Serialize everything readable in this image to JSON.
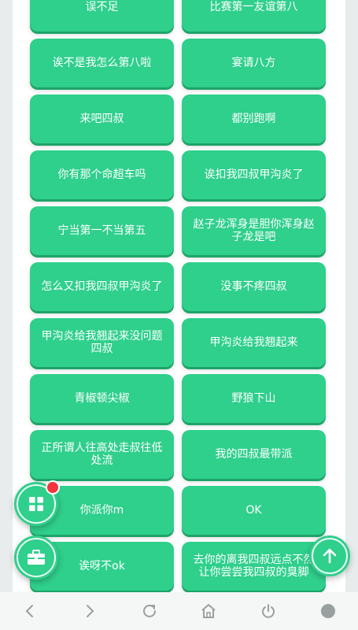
{
  "buttons": [
    {
      "label": "误不足"
    },
    {
      "label": "比赛第一友谊第八"
    },
    {
      "label": "诶不是我怎么第八啦"
    },
    {
      "label": "宴请八方"
    },
    {
      "label": "来吧四叔"
    },
    {
      "label": "都别跑啊"
    },
    {
      "label": "你有那个命超车吗"
    },
    {
      "label": "诶扣我四叔甲沟炎了"
    },
    {
      "label": "宁当第一不当第五"
    },
    {
      "label": "赵子龙浑身是胆你浑身赵子龙是吧"
    },
    {
      "label": "怎么又扣我四叔甲沟炎了"
    },
    {
      "label": "没事不疼四叔"
    },
    {
      "label": "甲沟炎给我翘起来没问题四叔"
    },
    {
      "label": "甲沟炎给我翘起来"
    },
    {
      "label": "青椒顿尖椒"
    },
    {
      "label": "野狼下山"
    },
    {
      "label": "正所谓人往高处走叔往低处流"
    },
    {
      "label": "我的四叔最带派"
    },
    {
      "label": "你派你m"
    },
    {
      "label": "OK"
    },
    {
      "label": "诶呀不ok"
    },
    {
      "label": "去你的离我四叔远点不然让你尝尝我四叔的臭脚"
    }
  ],
  "icons": {
    "apps": "grid-icon",
    "toolbox": "toolbox-icon",
    "top": "arrow-up-icon",
    "back": "chevron-left-icon",
    "forward": "chevron-right-icon",
    "reload": "reload-icon",
    "home": "home-icon",
    "power": "power-icon",
    "tabs": "circle-icon"
  },
  "colors": {
    "accent": "#2fcf8c",
    "badge": "#f2353e"
  }
}
